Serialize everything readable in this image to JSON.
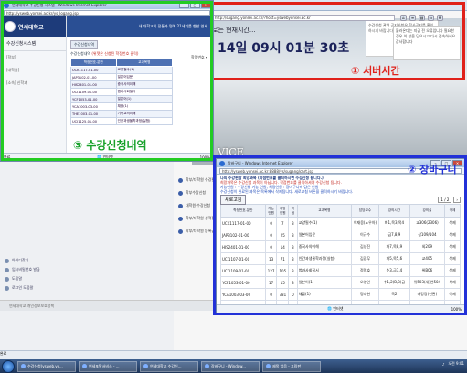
{
  "background": {
    "heading1": "로는 현재시간...",
    "heading2": "14일 09시 01분 30초",
    "address": "http://sugang.yonsei.ac.kr/?host=yswebyonsei.ac.kr",
    "vice": "VICE",
    "notice": "수강신청 관련 공지사항은 학사공지를 확인하시기 바랍니다.",
    "menu": [
      "학부/대학원 수강편람 조회",
      "학부수강신청",
      "대학원 수강신청",
      "학부/대학원 성적평가 결과",
      "학부/대학원 등록금 납부"
    ],
    "links": [
      "아이디찾기",
      "임시비밀번호 발급",
      "도움말",
      "로그인 도움말"
    ],
    "footer": "연세대학교 개인정보보호정책",
    "status_left": "완료",
    "status_zone": "인터넷",
    "status_zoom": "100%"
  },
  "window3": {
    "title": "연세대학교 수강신청 시스템 - Windows Internet Explorer",
    "address": "http://ysweb.yonsei.ac.kr/ys_logang.jsp",
    "logo_text": "연세대학교",
    "system_label": "수강신청시스템",
    "side_items": [
      "[학부]",
      "[대학원]",
      "[소속] 신학과"
    ],
    "banner_text": "새 대학교의 전통과 명예 21세기를 향한 연세",
    "section_tab": "수강신청내역",
    "list_label": "수강신청내역",
    "list_note": "(위젯은 신청된 학정번호 클릭)",
    "sort_label": "학정번호",
    "columns": [
      "학정번호-분반",
      "교과목명"
    ],
    "rows": [
      [
        "UCK1117-01-00",
        "교양필수(1)"
      ],
      [
        "JAP3102-01-00",
        "일본어입문"
      ],
      [
        "HIS2401-01-00",
        "중국사의이해"
      ],
      [
        "UCI1109-01-00",
        "법과사회질서"
      ],
      [
        "YCF1053-01-00",
        "일본어(1)"
      ],
      [
        "YCA1003-03-00",
        "채플(1)"
      ],
      [
        "THE1003-01-00",
        "기독교의이해"
      ],
      [
        "UCI1125-01-00",
        "인간과생물학과정(실험)"
      ]
    ],
    "annotation": "③ 수강신청내역",
    "status_left": "완료",
    "status_zone": "인터넷",
    "status_zoom": "100%"
  },
  "window1": {
    "address": "http://sugang.yonsei.ac.kr/?host=yswebyonsei.ac.kr",
    "caption": "로는 현재시간...",
    "time": "14일 09시 01분 30초",
    "notice": "불러온다는 지금 전 오류입니다 필요한 경우 이 창을 닫으시고 다시 접속하세요 감사합니다",
    "annotation": "① 서버시간"
  },
  "window2": {
    "title": "장바구니 - Windows Internet Explorer",
    "address": "http://ysweb.yonsei.ac.kr:8888/ys/sugang/cart.jsp",
    "heading": "나의 수강편람 희망과목 (학점번호를 클릭하시면 수강신청 됩니다.)",
    "note1": "희망과목은 수강신청 과목이 아닙니다. 학점번호를 클릭하셔야 수강신청 됩니다.",
    "note2": "가능인원 : 수강신청 가능 인원, 희망인원 : 장바구니에 담은 인원",
    "note3": "수강신청이 완료된 과목은 목록에서 삭제됩니다. 새로고침 버튼을 클릭하시기 바랍니다.",
    "refresh_button": "새로고침",
    "page_info": "1 / 2",
    "columns": [
      "학정번호-분반",
      "가능인원",
      "희망인원",
      "학점",
      "교과목명",
      "담당교수",
      "강의시간",
      "강의실",
      "삭제"
    ],
    "rows": [
      [
        "UCK1117-01-00",
        "0",
        "7",
        "3",
        "교양필수(1)",
        "이재웅(노우아)",
        "화1,목3,목4",
        "교306(2306)",
        "삭제"
      ],
      [
        "JAP3102-01-00",
        "0",
        "25",
        "3",
        "일본어입문",
        "이규수",
        "금7,8,9",
        "삼109/104",
        "삭제"
      ],
      [
        "HIS2401-01-00",
        "0",
        "14",
        "3",
        "중국사의이해",
        "김성진",
        "화7,목8,9",
        "외209",
        "삭제"
      ],
      [
        "UCI1107-01-00",
        "13",
        "71",
        "3",
        "인간과생물학과정(실험)",
        "김광무",
        "화5,목5,6",
        "교405",
        "삭제"
      ],
      [
        "UCI1109-01-00",
        "127",
        "105",
        "3",
        "법과사회질서",
        "정명호",
        "수3,금3,4",
        "위B06",
        "삭제"
      ],
      [
        "YCF1053-01-00",
        "17",
        "15",
        "3",
        "일본어(1)",
        "오영인",
        "수1,2(B,3)금",
        "위503(세)연504",
        "삭제"
      ],
      [
        "YCA1003-03-00",
        "0",
        "781",
        "0",
        "채플(1)",
        "정대현",
        "목2",
        "대강당(신관)",
        "삭제"
      ],
      [
        "THE1003-01-00",
        "87",
        "38",
        "3",
        "기독교의이해",
        "박성민",
        "금4",
        "신과대401",
        "삭제"
      ]
    ],
    "annotation": "② 장바구니",
    "status_zone": "인터넷",
    "status_zoom": "100%"
  },
  "taskbar": {
    "items": [
      "수강신청(ysweb.yo...",
      "연세포탈서비스 - ...",
      "연세대학교 수강신...",
      "장바구니 - Window...",
      "제목 없음 - 그림판"
    ],
    "clock": "오전 9:01"
  },
  "colors": {
    "annotation_red": "#e0221b",
    "annotation_blue": "#2231d8",
    "annotation_green": "#22cc22",
    "brand_navy": "#1d3b7a"
  }
}
